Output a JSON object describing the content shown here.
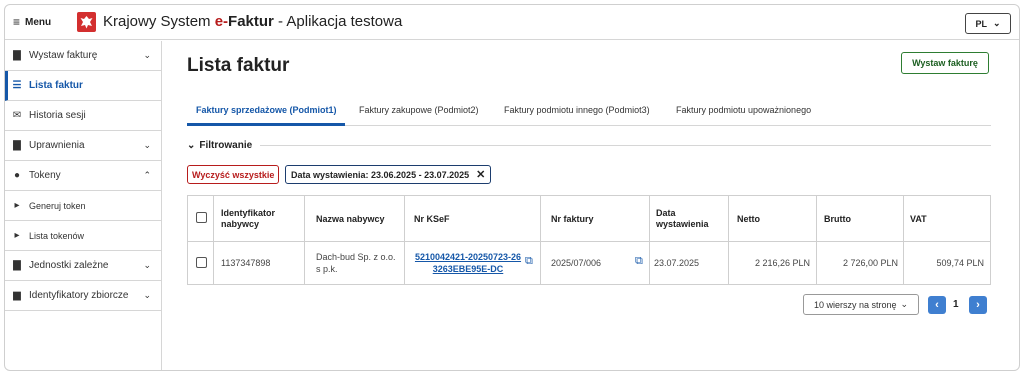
{
  "header": {
    "menu_label": "Menu",
    "title_prefix": "Krajowy System ",
    "title_e": "e-",
    "title_faktur": "Faktur",
    "title_suffix": " - Aplikacja testowa",
    "lang": "PL"
  },
  "sidebar": {
    "items": [
      {
        "label": "Wystaw fakturę",
        "icon": "document-icon"
      },
      {
        "label": "Lista faktur",
        "icon": "list-icon"
      },
      {
        "label": "Historia sesji",
        "icon": "envelope-icon"
      },
      {
        "label": "Uprawnienia",
        "icon": "document-icon"
      },
      {
        "label": "Tokeny",
        "icon": "token-icon"
      },
      {
        "label": "Generuj token"
      },
      {
        "label": "Lista tokenów"
      },
      {
        "label": "Jednostki zależne",
        "icon": "document-icon"
      },
      {
        "label": "Identyfikatory zbiorcze",
        "icon": "id-card-icon"
      }
    ]
  },
  "main": {
    "title": "Lista faktur",
    "issue_button": "Wystaw fakturę",
    "tabs": [
      "Faktury sprzedażowe (Podmiot1)",
      "Faktury zakupowe (Podmiot2)",
      "Faktury podmiotu innego (Podmiot3)",
      "Faktury podmiotu upoważnionego"
    ],
    "filter_title": "Filtrowanie",
    "clear_all": "Wyczyść wszystkie",
    "date_chip": "Data wystawienia: 23.06.2025 - 23.07.2025"
  },
  "table": {
    "headers": [
      "Identyfikator nabywcy",
      "Nazwa nabywcy",
      "Nr KSeF",
      "Nr faktury",
      "Data wystawienia",
      "Netto",
      "Brutto",
      "VAT"
    ],
    "rows": [
      {
        "buyer_id": "1137347898",
        "buyer_name": "Dach-bud Sp. z o.o. s p.k.",
        "ksef_line1": "5210042421-20250723-26",
        "ksef_line2": "3263EBE95E-DC",
        "invoice_no": "2025/07/006",
        "date": "23.07.2025",
        "net": "2 216,26 PLN",
        "gross": "2 726,00 PLN",
        "vat": "509,74 PLN"
      }
    ]
  },
  "pagination": {
    "rows_per_page": "10 wierszy na stronę",
    "page": "1"
  },
  "colors": {
    "accent": "#1557a8",
    "danger": "#b71c1c",
    "success": "#2e7d32"
  }
}
